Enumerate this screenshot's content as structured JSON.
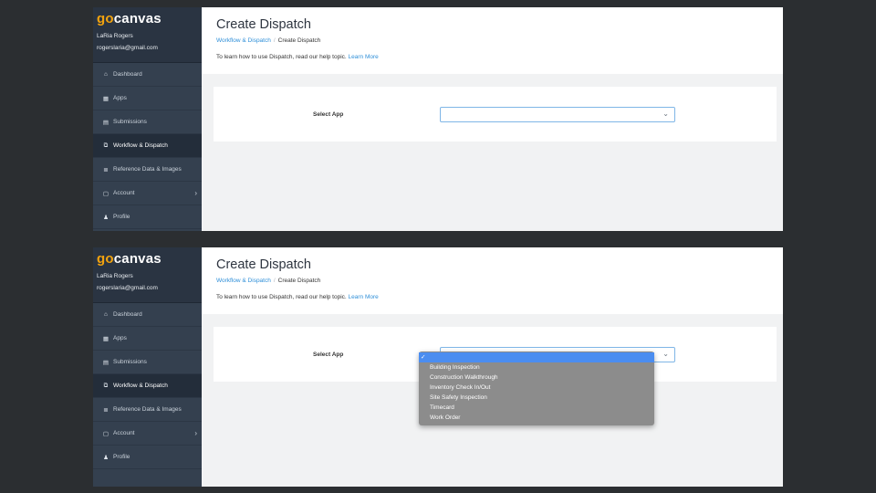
{
  "brand": {
    "logo_go": "go",
    "logo_rest": "canvas"
  },
  "user": {
    "name": "LaRia Rogers",
    "email": "rogerslaria@gmail.com"
  },
  "sidebar": {
    "items": [
      {
        "label": "Dashboard",
        "icon": "home-icon"
      },
      {
        "label": "Apps",
        "icon": "grid-icon"
      },
      {
        "label": "Submissions",
        "icon": "document-icon"
      },
      {
        "label": "Workflow & Dispatch",
        "icon": "dispatch-icon",
        "active": true
      },
      {
        "label": "Reference Data & Images",
        "icon": "database-icon"
      },
      {
        "label": "Account",
        "icon": "account-icon",
        "has_chevron": true
      },
      {
        "label": "Profile",
        "icon": "person-icon"
      }
    ]
  },
  "page": {
    "title": "Create Dispatch",
    "breadcrumb": {
      "parent": "Workflow & Dispatch",
      "separator": "/",
      "current": "Create Dispatch"
    },
    "help_text": "To learn how to use Dispatch, read our help topic.",
    "help_link": "Learn More"
  },
  "form": {
    "select_label": "Select App",
    "selected_value": ""
  },
  "dropdown": {
    "checkmark": "✓",
    "options": [
      "",
      "Building Inspection",
      "Construction Walkthrough",
      "Inventory Check In/Out",
      "Site Safety Inspection",
      "Timecard",
      "Work Order"
    ]
  },
  "colors": {
    "accent": "#2f8fd8",
    "brand_orange": "#f2a30f",
    "sidebar": "#34404f",
    "dropdown_highlight": "#4b8df0"
  }
}
